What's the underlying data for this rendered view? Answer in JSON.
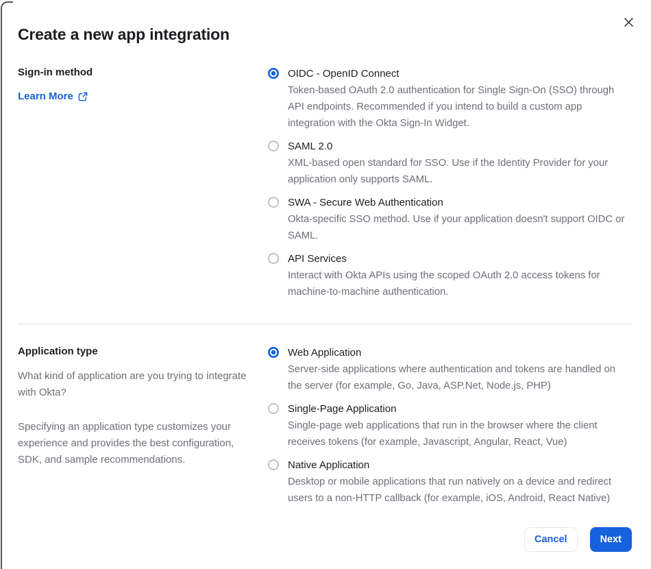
{
  "modal": {
    "title": "Create a new app integration"
  },
  "colors": {
    "accent_blue": "#1662dd",
    "text_dark": "#1d1d21",
    "text_gray": "#6e6e78",
    "divider": "#e3e3e8",
    "radio_unselected_border": "#c1c1c8",
    "modal_edge": "#55555a"
  },
  "icons": {
    "close": "close-icon",
    "external_link": "external-link-icon",
    "radio_selected": "radio-selected-icon",
    "radio_unselected": "radio-unselected-icon"
  },
  "signin_section": {
    "heading": "Sign-in method",
    "learn_more_label": "Learn More",
    "options": [
      {
        "label": "OIDC - OpenID Connect",
        "description": "Token-based OAuth 2.0 authentication for Single Sign-On (SSO) through API endpoints. Recommended if you intend to build a custom app integration with the Okta Sign-In Widget.",
        "selected": true
      },
      {
        "label": "SAML 2.0",
        "description": "XML-based open standard for SSO. Use if the Identity Provider for your application only supports SAML.",
        "selected": false
      },
      {
        "label": "SWA - Secure Web Authentication",
        "description": "Okta-specific SSO method. Use if your application doesn't support OIDC or SAML.",
        "selected": false
      },
      {
        "label": "API Services",
        "description": "Interact with Okta APIs using the scoped OAuth 2.0 access tokens for machine-to-machine authentication.",
        "selected": false
      }
    ]
  },
  "apptype_section": {
    "heading": "Application type",
    "paragraph1": "What kind of application are you trying to integrate with Okta?",
    "paragraph2": "Specifying an application type customizes your experience and provides the best configuration, SDK, and sample recommendations.",
    "options": [
      {
        "label": "Web Application",
        "description": "Server-side applications where authentication and tokens are handled on the server (for example, Go, Java, ASP.Net, Node.js, PHP)",
        "selected": true
      },
      {
        "label": "Single-Page Application",
        "description": "Single-page web applications that run in the browser where the client receives tokens (for example, Javascript, Angular, React, Vue)",
        "selected": false
      },
      {
        "label": "Native Application",
        "description": "Desktop or mobile applications that run natively on a device and redirect users to a non-HTTP callback (for example, iOS, Android, React Native)",
        "selected": false
      }
    ]
  },
  "footer": {
    "cancel_label": "Cancel",
    "next_label": "Next"
  }
}
